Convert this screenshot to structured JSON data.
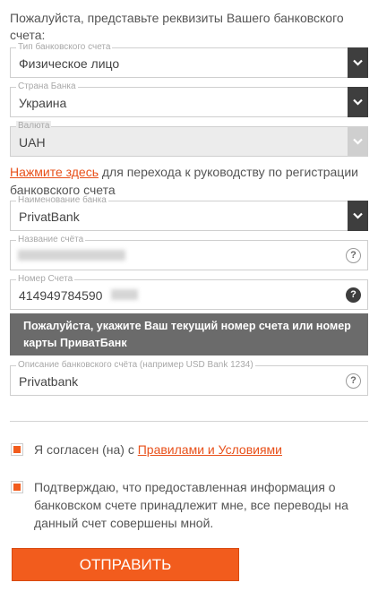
{
  "intro": "Пожалуйста, представьте реквизиты Вашего банковского счета:",
  "account_type": {
    "label": "Тип банковского счета",
    "value": "Физическое лицо"
  },
  "bank_country": {
    "label": "Страна Банка",
    "value": "Украина"
  },
  "currency": {
    "label": "Валюта",
    "value": "UAH"
  },
  "guide": {
    "link": "Нажмите здесь",
    "text": " для перехода к руководству по регистрации банковского счета"
  },
  "bank_name": {
    "label": "Наименование банка",
    "value": "PrivatBank"
  },
  "account_name": {
    "label": "Название счёта",
    "value": ""
  },
  "account_number": {
    "label": "Номер Счета",
    "value": "414949784590"
  },
  "tooltip": "Пожалуйста, укажите Ваш текущий номер счета или номер карты ПриватБанк",
  "description": {
    "label": "Описание банковского счёта (например USD Bank 1234)",
    "value": "Privatbank"
  },
  "help_symbol": "?",
  "agree": {
    "prefix": "Я согласен (на) с ",
    "link": "Правилами и Условиями"
  },
  "confirm": "Подтверждаю, что предоставленная информация о банковском счете принадлежит мне, все переводы на данный счет совершены мной.",
  "submit_label": "Отправить",
  "colors": {
    "accent": "#f25c1d",
    "link": "#e8501a",
    "dark": "#3e3e3e",
    "tooltip_bg": "#6b6b6b"
  }
}
